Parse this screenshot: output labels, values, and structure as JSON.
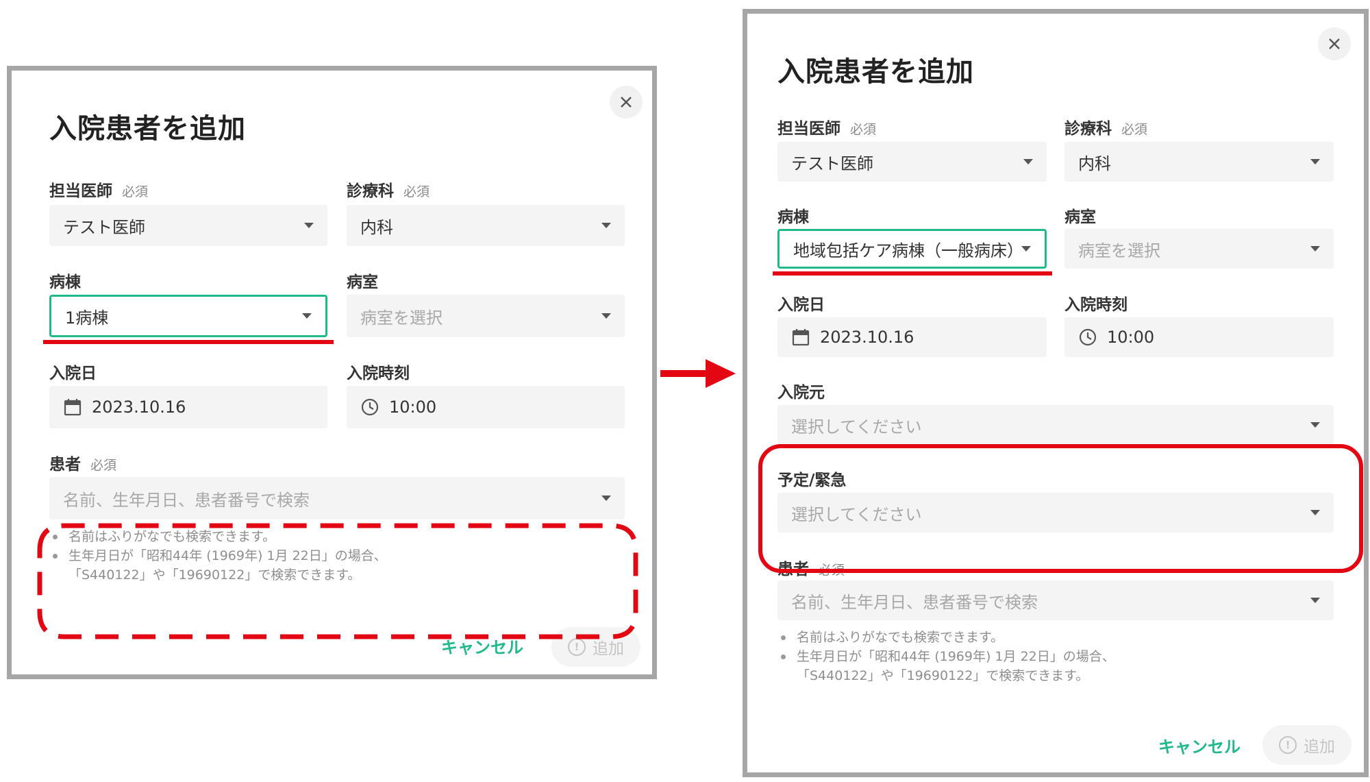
{
  "before": {
    "title": "入院患者を追加",
    "doctor": {
      "label": "担当医師",
      "required": "必須",
      "value": "テスト医師"
    },
    "department": {
      "label": "診療科",
      "required": "必須",
      "value": "内科"
    },
    "ward": {
      "label": "病棟",
      "value": "1病棟"
    },
    "room": {
      "label": "病室",
      "placeholder": "病室を選択"
    },
    "admission_date": {
      "label": "入院日",
      "value": "2023.10.16"
    },
    "admission_time": {
      "label": "入院時刻",
      "value": "10:00"
    },
    "patient": {
      "label": "患者",
      "required": "必須",
      "placeholder": "名前、生年月日、患者番号で検索"
    },
    "hints": [
      "名前はふりがなでも検索できます。",
      "生年月日が「昭和44年 (1969年) 1月 22日」の場合、",
      "「S440122」や「19690122」で検索できます。"
    ],
    "cancel_label": "キャンセル",
    "add_label": "追加"
  },
  "after": {
    "title": "入院患者を追加",
    "doctor": {
      "label": "担当医師",
      "required": "必須",
      "value": "テスト医師"
    },
    "department": {
      "label": "診療科",
      "required": "必須",
      "value": "内科"
    },
    "ward": {
      "label": "病棟",
      "value": "地域包括ケア病棟（一般病床）"
    },
    "room": {
      "label": "病室",
      "placeholder": "病室を選択"
    },
    "admission_date": {
      "label": "入院日",
      "value": "2023.10.16"
    },
    "admission_time": {
      "label": "入院時刻",
      "value": "10:00"
    },
    "admission_source": {
      "label": "入院元",
      "placeholder": "選択してください"
    },
    "planned_emergency": {
      "label": "予定/緊急",
      "placeholder": "選択してください"
    },
    "patient": {
      "label": "患者",
      "required": "必須",
      "placeholder": "名前、生年月日、患者番号で検索"
    },
    "hints": [
      "名前はふりがなでも検索できます。",
      "生年月日が「昭和44年 (1969年) 1月 22日」の場合、",
      "「S440122」や「19690122」で検索できます。"
    ],
    "cancel_label": "キャンセル",
    "add_label": "追加"
  },
  "colors": {
    "accent": "#20b98a",
    "annotation_red": "#e30613",
    "border_gray": "#a6a6a6"
  },
  "icons": [
    "close-icon",
    "caret-down-icon",
    "calendar-icon",
    "clock-icon",
    "alert-circle-icon",
    "arrow-right-icon"
  ]
}
